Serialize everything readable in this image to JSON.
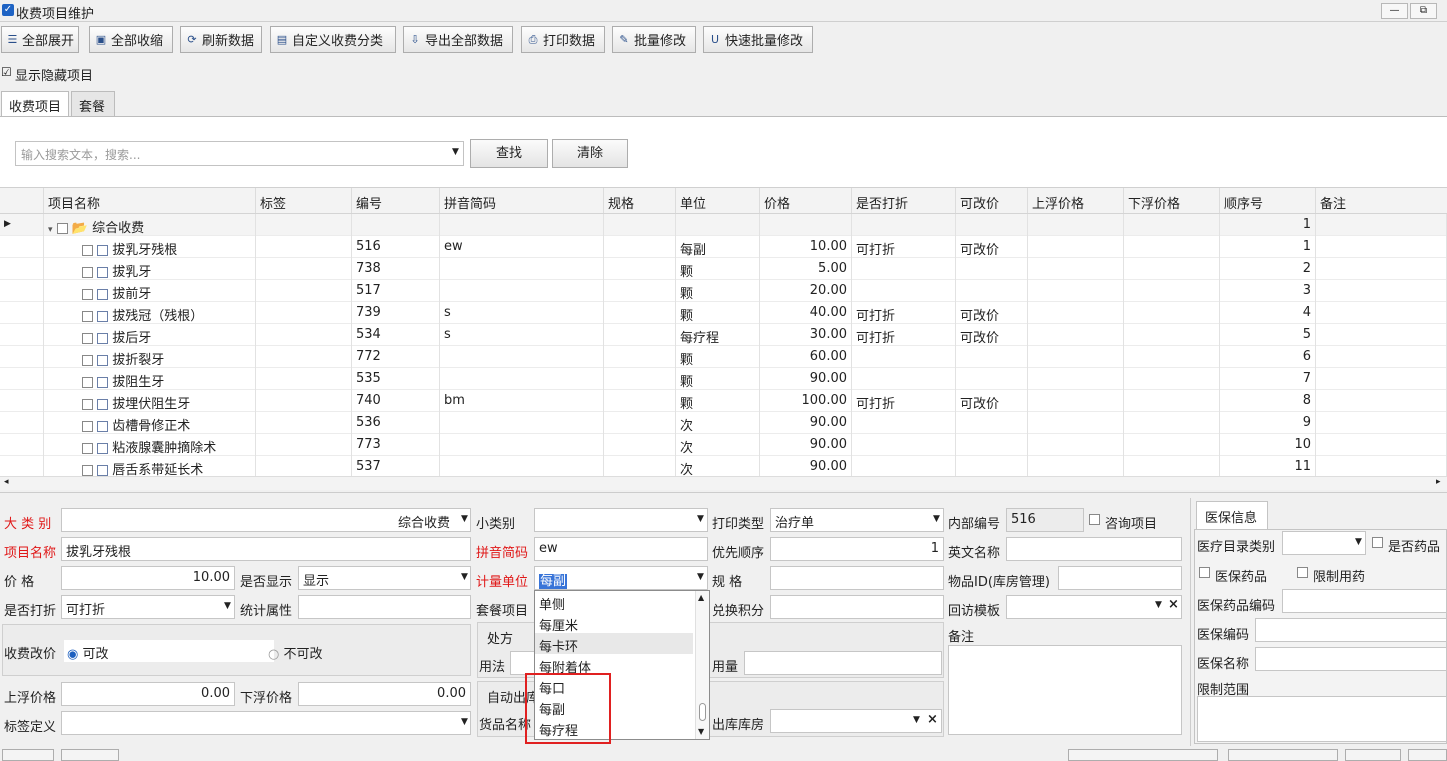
{
  "window": {
    "title": "收费项目维护",
    "min": "—",
    "restore": "⧉"
  },
  "toolbar": [
    {
      "icon": "tree-expand-icon",
      "glyph": "☰",
      "label": "全部展开"
    },
    {
      "icon": "collapse-icon",
      "glyph": "▣",
      "label": "全部收缩"
    },
    {
      "icon": "refresh-icon",
      "glyph": "⟳",
      "label": "刷新数据"
    },
    {
      "icon": "category-icon",
      "glyph": "▤",
      "label": "自定义收费分类"
    },
    {
      "icon": "export-icon",
      "glyph": "⇩",
      "label": "导出全部数据"
    },
    {
      "icon": "print-icon",
      "glyph": "⎙",
      "label": "打印数据"
    },
    {
      "icon": "batch-edit-icon",
      "glyph": "✎",
      "label": "批量修改"
    },
    {
      "icon": "quick-batch-icon",
      "glyph": "U",
      "label": "快速批量修改"
    }
  ],
  "show_hidden": {
    "checked": true,
    "label": "显示隐藏项目"
  },
  "tabs": [
    "收费项目",
    "套餐"
  ],
  "search": {
    "placeholder": "输入搜索文本，搜索...",
    "find": "查找",
    "clear": "清除"
  },
  "grid": {
    "columns": [
      "项目名称",
      "标签",
      "编号",
      "拼音简码",
      "规格",
      "单位",
      "价格",
      "是否打折",
      "可改价",
      "上浮价格",
      "下浮价格",
      "顺序号",
      "备注"
    ],
    "group": {
      "name": "综合收费",
      "order": "1"
    },
    "rows": [
      {
        "name": "拔乳牙残根",
        "code": "516",
        "py": "ew",
        "unit": "每副",
        "price": "10.00",
        "discount": "可打折",
        "editable": "可改价",
        "order": "1"
      },
      {
        "name": "拔乳牙",
        "code": "738",
        "py": "",
        "unit": "颗",
        "price": "5.00",
        "discount": "",
        "editable": "",
        "order": "2"
      },
      {
        "name": "拔前牙",
        "code": "517",
        "py": "",
        "unit": "颗",
        "price": "20.00",
        "discount": "",
        "editable": "",
        "order": "3"
      },
      {
        "name": "拔残冠（残根）",
        "code": "739",
        "py": "s",
        "unit": "颗",
        "price": "40.00",
        "discount": "可打折",
        "editable": "可改价",
        "order": "4"
      },
      {
        "name": "拔后牙",
        "code": "534",
        "py": "s",
        "unit": "每疗程",
        "price": "30.00",
        "discount": "可打折",
        "editable": "可改价",
        "order": "5"
      },
      {
        "name": "拔折裂牙",
        "code": "772",
        "py": "",
        "unit": "颗",
        "price": "60.00",
        "discount": "",
        "editable": "",
        "order": "6"
      },
      {
        "name": "拔阻生牙",
        "code": "535",
        "py": "",
        "unit": "颗",
        "price": "90.00",
        "discount": "",
        "editable": "",
        "order": "7"
      },
      {
        "name": "拔埋伏阻生牙",
        "code": "740",
        "py": "bm",
        "unit": "颗",
        "price": "100.00",
        "discount": "可打折",
        "editable": "可改价",
        "order": "8"
      },
      {
        "name": "齿槽骨修正术",
        "code": "536",
        "py": "",
        "unit": "次",
        "price": "90.00",
        "discount": "",
        "editable": "",
        "order": "9"
      },
      {
        "name": "粘液腺囊肿摘除术",
        "code": "773",
        "py": "",
        "unit": "次",
        "price": "90.00",
        "discount": "",
        "editable": "",
        "order": "10"
      },
      {
        "name": "唇舌系带延长术",
        "code": "537",
        "py": "",
        "unit": "次",
        "price": "90.00",
        "discount": "",
        "editable": "",
        "order": "11"
      }
    ]
  },
  "form": {
    "category_label": "大 类 别",
    "category_value": "综合收费",
    "subcategory_label": "小类别",
    "subcategory_value": "",
    "print_type_label": "打印类型",
    "print_type_value": "治疗单",
    "internal_code_label": "内部编号",
    "internal_code_value": "516",
    "consult_label": "咨询项目",
    "name_label": "项目名称",
    "name_value": "拔乳牙残根",
    "pinyin_label": "拼音简码",
    "pinyin_value": "ew",
    "priority_label": "优先顺序",
    "priority_value": "1",
    "english_label": "英文名称",
    "english_value": "",
    "price_label": "价 格",
    "price_value": "10.00",
    "display_label": "是否显示",
    "display_value": "显示",
    "unit_label": "计量单位",
    "unit_value": "每副",
    "spec_label": "规 格",
    "spec_value": "",
    "goods_id_label": "物品ID(库房管理)",
    "goods_id_value": "",
    "discount_label": "是否打折",
    "discount_value": "可打折",
    "stat_label": "统计属性",
    "stat_value": "",
    "package_label": "套餐项目",
    "points_label": "兑换积分",
    "points_value": "",
    "followup_label": "回访模板",
    "followup_value": "",
    "modify_label": "收费改价",
    "modify_yes": "可改",
    "modify_no": "不可改",
    "rx_label": "处方",
    "usage_label": "用法",
    "dosage_label": "用量",
    "notes_label": "备注",
    "up_label": "上浮价格",
    "up_value": "0.00",
    "down_label": "下浮价格",
    "down_value": "0.00",
    "auto_out_label": "自动出库",
    "tagdef_label": "标签定义",
    "goods_name_label": "货品名称",
    "warehouse_label": "出库库房",
    "warehouse_value": ""
  },
  "unit_dropdown": [
    "单侧",
    "每厘米",
    "每卡环",
    "每附着体",
    "每口",
    "每副",
    "每疗程"
  ],
  "insurance": {
    "tab": "医保信息",
    "catalog_label": "医疗目录类别",
    "catalog_value": "",
    "is_drug_label": "是否药品",
    "ins_drug_label": "医保药品",
    "restricted_label": "限制用药",
    "drug_code_label": "医保药品编码",
    "code_label": "医保编码",
    "name_label": "医保名称",
    "scope_label": "限制范围"
  }
}
